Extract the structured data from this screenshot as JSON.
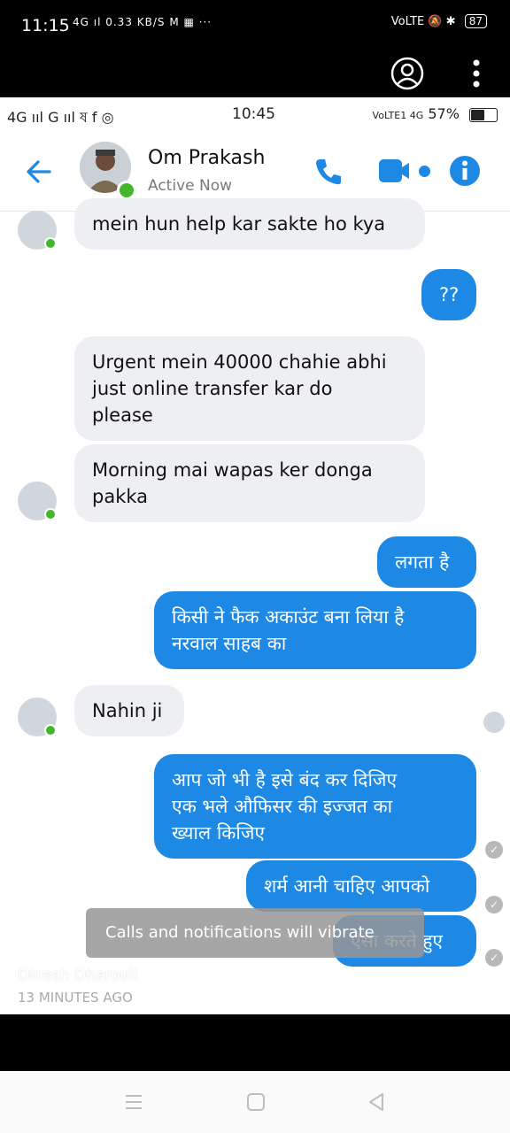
{
  "outer_status": {
    "time": "11:15",
    "left_icons": "4G ıl 0.33 KB/S M ▦ ···",
    "right_icons": "VoLTE 🔕 ✱",
    "battery": "87"
  },
  "inner_status": {
    "left_icons": "4G ııl G ııl ষ f ◎",
    "time": "10:45",
    "right_icons": "VoLTE1 4G",
    "battery": "57%",
    "battery_level": 0.57
  },
  "header": {
    "contact_name": "Om Prakash",
    "status": "Active Now"
  },
  "messages": [
    {
      "direction": "in",
      "text": "mein hun help kar sakte ho kya"
    },
    {
      "direction": "out",
      "text": "??"
    },
    {
      "direction": "in",
      "text": "Urgent mein 40000 chahie abhi\njust online transfer kar do\nplease"
    },
    {
      "direction": "in",
      "text": "Morning mai wapas ker donga\npakka"
    },
    {
      "direction": "out",
      "text": "लगता है"
    },
    {
      "direction": "out",
      "text": "किसी ने फैक अकाउंट बना लिया है\nनरवाल साहब का"
    },
    {
      "direction": "in",
      "text": "Nahin ji"
    },
    {
      "direction": "out",
      "text": "आप जो भी है इसे बंद कर दिजिए\nएक भले औफिसर की इज्जत का\nख्याल किजिए"
    },
    {
      "direction": "out",
      "text": "शर्म आनी चाहिए आपको"
    },
    {
      "direction": "out",
      "text": "ऐसा करते हुए"
    }
  ],
  "toast": "Calls and notifications will vibrate",
  "overlay": {
    "poster": "Dinesh Dharouli",
    "time": "13 MINUTES AGO"
  },
  "colors": {
    "accent": "#1e88e5",
    "incoming_bubble": "#eeeff2",
    "online": "#42b72a"
  }
}
